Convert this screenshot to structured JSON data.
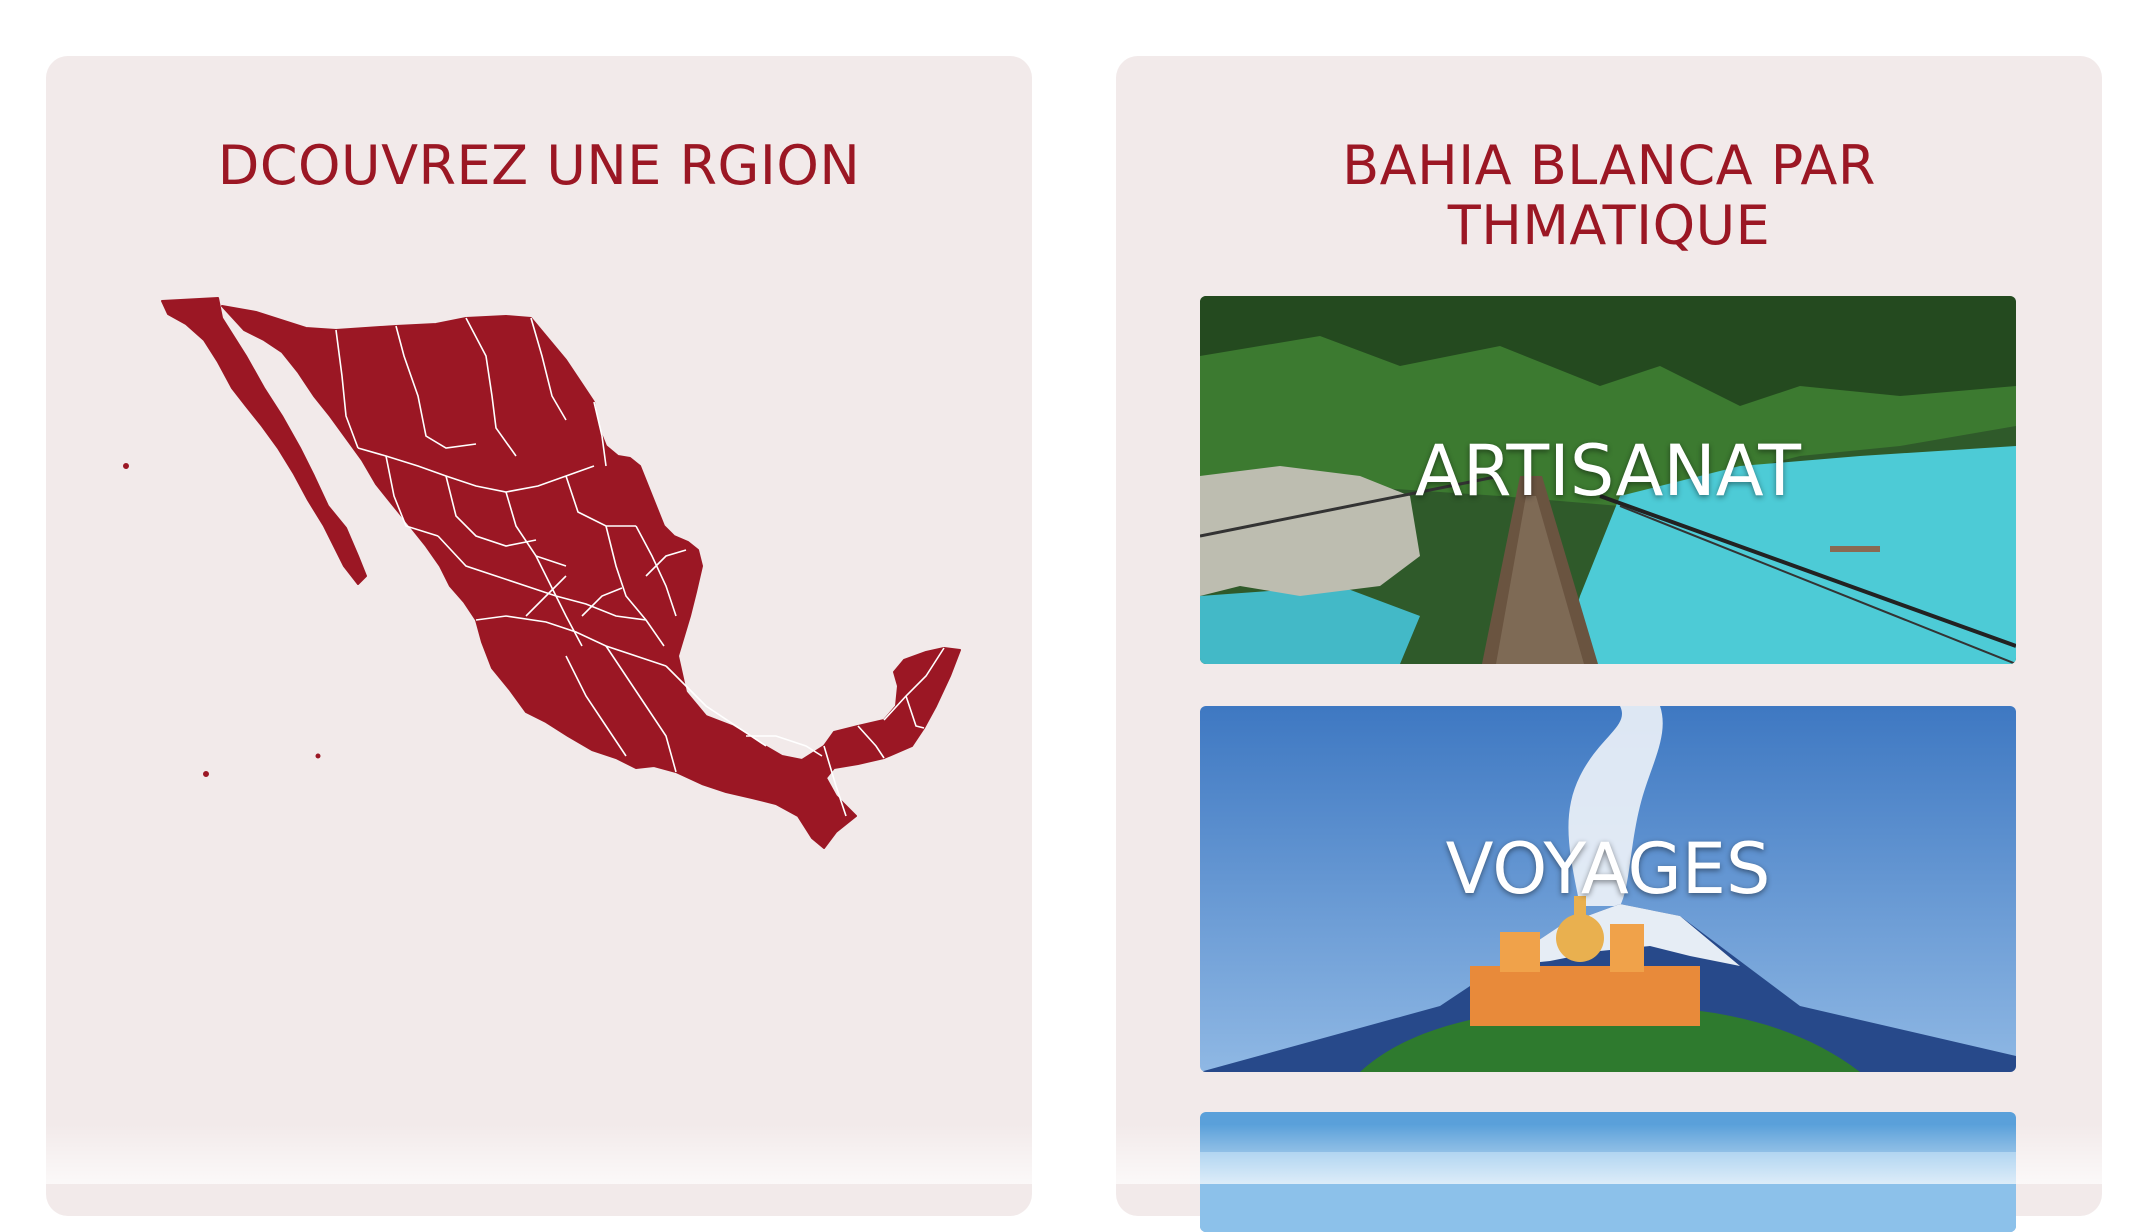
{
  "regions_panel": {
    "title": "DCOUVREZ UNE RGION",
    "map_icon": "mexico-map",
    "map_color": "#9b1724"
  },
  "themes_panel": {
    "title": "BAHIA BLANCA PAR THMATIQUE",
    "cards": [
      {
        "label": "ARTISANAT",
        "image": "suspension-bridge-over-turquoise-river"
      },
      {
        "label": "VOYAGES",
        "image": "volcano-with-church-on-hill"
      },
      {
        "label": "",
        "image": "blue-sky-landscape"
      }
    ]
  },
  "colors": {
    "accent": "#9b1724",
    "panel_bg": "#f2eaea",
    "label_text": "#ffffff"
  }
}
